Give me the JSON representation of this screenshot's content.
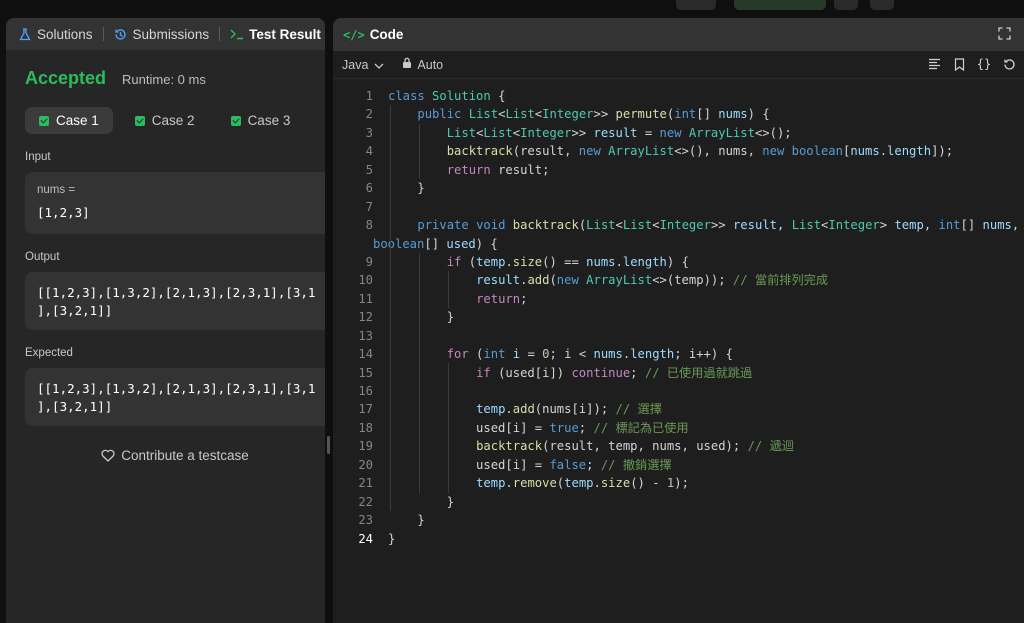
{
  "left_panel": {
    "tabs": [
      {
        "label": "Solutions",
        "icon": "flask-icon"
      },
      {
        "label": "Submissions",
        "icon": "history-icon"
      },
      {
        "label": "Test Result",
        "icon": "terminal-icon"
      }
    ],
    "status": "Accepted",
    "runtime": "Runtime: 0 ms",
    "cases": [
      "Case 1",
      "Case 2",
      "Case 3"
    ],
    "input_label": "Input",
    "input_var": "nums =",
    "input_value": "[1,2,3]",
    "output_label": "Output",
    "output_value": "[[1,2,3],[1,3,2],[2,1,3],[2,3,1],[3,1\n],[3,2,1]]",
    "expected_label": "Expected",
    "expected_value": "[[1,2,3],[1,3,2],[2,1,3],[2,3,1],[3,1\n],[3,2,1]]",
    "contribute": "Contribute a testcase"
  },
  "right_panel": {
    "title": "Code",
    "language": "Java",
    "mode": "Auto"
  },
  "code": {
    "line_numbers": [
      "1",
      "2",
      "3",
      "4",
      "5",
      "6",
      "7",
      "8",
      "",
      "9",
      "10",
      "11",
      "12",
      "13",
      "14",
      "15",
      "16",
      "17",
      "18",
      "19",
      "20",
      "21",
      "22",
      "23",
      "24"
    ]
  },
  "colors": {
    "accent_green": "#2cbb5d",
    "panel_bg": "#262626",
    "editor_bg": "#1e1e1e"
  }
}
